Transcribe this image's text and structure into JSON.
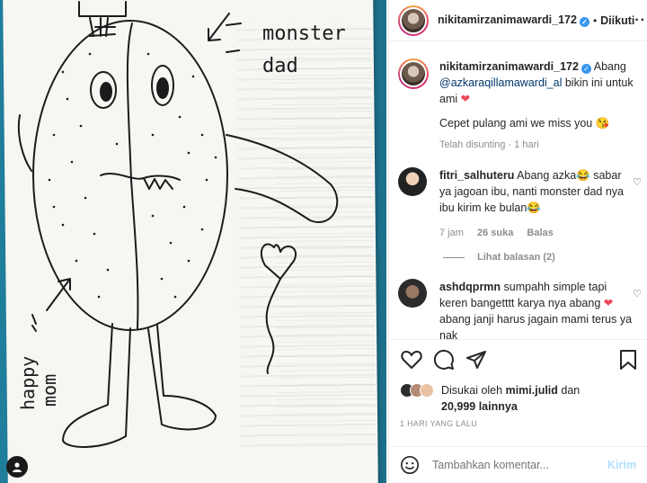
{
  "drawing": {
    "label_dad": [
      "monster",
      "dad"
    ],
    "label_mom": [
      "happy",
      "mom"
    ]
  },
  "post": {
    "author": "nikitamirzanimawardi_172",
    "follow_label": "Diikuti",
    "caption_mention": "@azkaraqillamawardi_al",
    "caption_pre": "Abang",
    "caption_post": "bikin ini untuk ami",
    "caption_line2": "Cepet pulang ami we miss you",
    "caption_meta": "Telah disunting · 1 hari"
  },
  "comments": [
    {
      "user": "fitri_salhuteru",
      "text": "Abang azka😂 sabar ya jagoan ibu, nanti monster dad nya ibu kirim ke bulan😂",
      "time": "7 jam",
      "likes": "26 suka",
      "reply": "Balas",
      "view_replies": "Lihat balasan (2)"
    },
    {
      "user": "ashdqprmn",
      "text_a": "sumpahh simple tapi keren bangetttt karya nya abang",
      "text_b": "abang janji harus jagain mami",
      "text_c": "terus ya nak"
    }
  ],
  "likes": {
    "prefix": "Disukai oleh",
    "user": "mimi.julid",
    "conj": "dan",
    "count": "20,999 lainnya"
  },
  "date": "1 HARI YANG LALU",
  "comment_box": {
    "placeholder": "Tambahkan komentar...",
    "post_label": "Kirim"
  },
  "colors": {
    "accent_blue": "#3897f0",
    "heart_red": "#ed4956",
    "post_disabled": "#b2dffc"
  }
}
